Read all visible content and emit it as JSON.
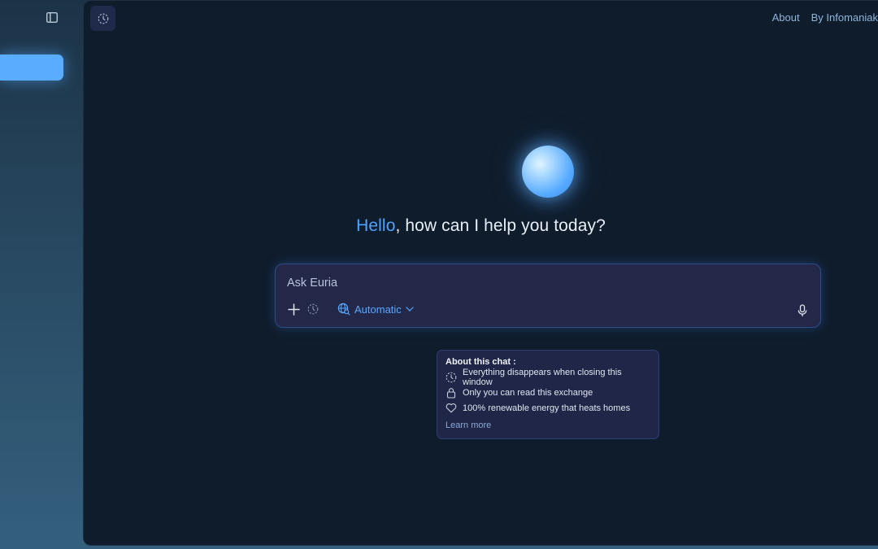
{
  "sidebar": {
    "toggle_icon": "sidebar-panel-icon",
    "active_item_label": "",
    "accent_color": "#5aacff"
  },
  "header": {
    "ephemeral_icon": "ephemeral-clock-icon",
    "nav": [
      {
        "label": "About"
      },
      {
        "label": "By Infomaniak"
      }
    ]
  },
  "hero": {
    "greeting_highlight": "Hello",
    "greeting_rest": ", how can I help you today?",
    "highlight_color": "#4da3ff"
  },
  "composer": {
    "placeholder": "Ask Euria",
    "value": "",
    "add_icon": "plus-icon",
    "ephemeral_icon": "ephemeral-clock-icon",
    "model_icon": "globe-search-icon",
    "model_label": "Automatic",
    "mic_icon": "microphone-icon"
  },
  "info_card": {
    "title": "About this chat :",
    "items": [
      {
        "icon": "ephemeral-clock-icon",
        "text": "Everything disappears when closing this window"
      },
      {
        "icon": "lock-icon",
        "text": "Only you can read this exchange"
      },
      {
        "icon": "heart-icon",
        "text": "100% renewable energy that heats homes"
      }
    ],
    "link_label": "Learn more"
  }
}
